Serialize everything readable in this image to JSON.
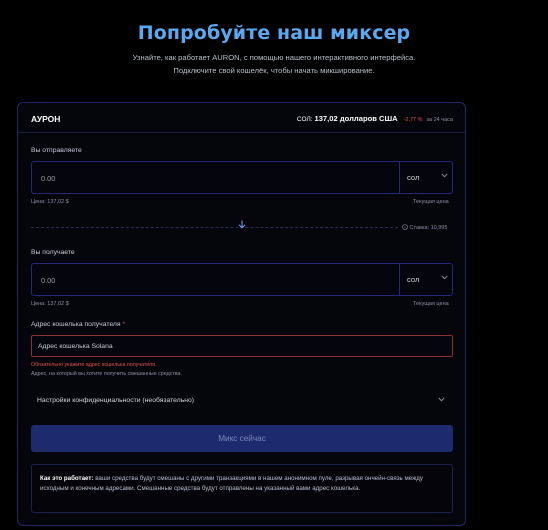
{
  "hero": {
    "title": "Попробуйте наш миксер",
    "subtitle_line1": "Узнайте, как работает AURON, с помощью нашего интерактивного интерфейса.",
    "subtitle_line2": "Подключите свой кошелёк, чтобы начать микширование."
  },
  "card": {
    "brand": "АУРОН",
    "price_symbol": "СОЛ:",
    "price": "137,02 долларов США",
    "change": "-2,77 %",
    "period": "за 24 часа"
  },
  "send": {
    "label": "Вы отправляете",
    "value": "0.00",
    "currency": "сол",
    "price_left": "Цена: 137,02 $",
    "price_right": "Текущая цена"
  },
  "swap": {
    "rate": "Ставка: 10,995"
  },
  "receive": {
    "label": "Вы получаете",
    "value": "0.00",
    "currency": "сол",
    "price_left": "Цена: 137,02 $",
    "price_right": "Текущая цена"
  },
  "address": {
    "label": "Адрес кошелька получателя",
    "required_mark": "*",
    "placeholder": "Адрес кошелька Solana",
    "error": "Обязательно укажите адрес кошелька получателя.",
    "hint": "Адрес, на который вы хотите получить смешанные средства."
  },
  "privacy": {
    "label": "Настройки конфиденциальности (необязательно)"
  },
  "mix_button": {
    "label": "Микс сейчас"
  },
  "info": {
    "bold": "Как это работает:",
    "text": " ваши средства будут смешаны с другими транзакциями в нашем анонимном пуле, разрывая ончейн-связь между исходным и конечным адресами. Смешанные средства будут отправлены на указанный вами адрес кошелька."
  },
  "colors": {
    "title_blue": "#5aa9f0",
    "card_border": "#24286a",
    "error_red": "#e0554e",
    "button_bg": "#1e2a6e"
  },
  "icons": {
    "chevron": "chevron-down-icon",
    "swap": "arrow-down-icon",
    "rate": "info-circle-icon"
  }
}
